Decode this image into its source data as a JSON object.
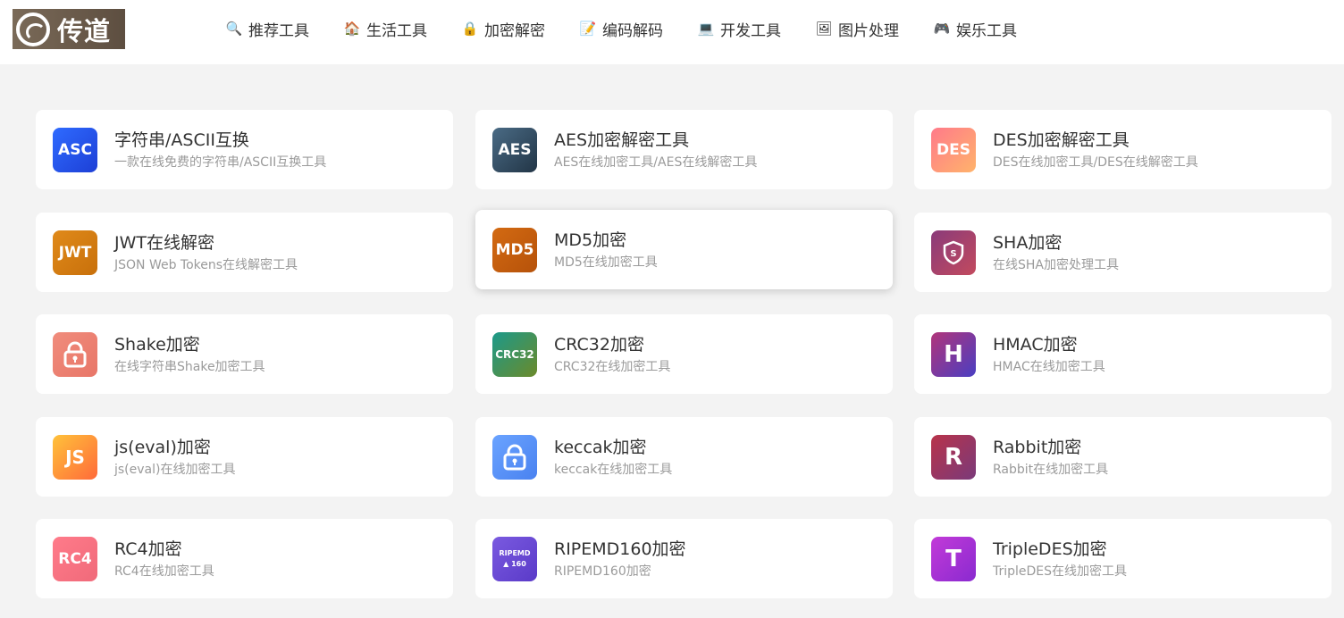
{
  "logo": {
    "text": "传道"
  },
  "nav": [
    {
      "label": "推荐工具",
      "icon": "magnifier-icon",
      "glyph": "🔍"
    },
    {
      "label": "生活工具",
      "icon": "house-icon",
      "glyph": "🏠"
    },
    {
      "label": "加密解密",
      "icon": "lock-icon",
      "glyph": "🔒"
    },
    {
      "label": "编码解码",
      "icon": "memo-icon",
      "glyph": "📝"
    },
    {
      "label": "开发工具",
      "icon": "laptop-icon",
      "glyph": "💻"
    },
    {
      "label": "图片处理",
      "icon": "picture-icon",
      "glyph": "🖼"
    },
    {
      "label": "娱乐工具",
      "icon": "gamepad-icon",
      "glyph": "🎮"
    }
  ],
  "tools": [
    {
      "title": "字符串/ASCII互换",
      "desc": "一款在线免费的字符串/ASCII互换工具",
      "tile": "ASC",
      "bg": "linear-gradient(135deg,#2f6bff,#1d3fd6)"
    },
    {
      "title": "AES加密解密工具",
      "desc": "AES在线加密工具/AES在线解密工具",
      "tile": "AES",
      "bg": "linear-gradient(135deg,#4a6b85,#223546)"
    },
    {
      "title": "DES加密解密工具",
      "desc": "DES在线加密工具/DES在线解密工具",
      "tile": "DES",
      "bg": "linear-gradient(135deg,#ff7a8a,#ffb36b)"
    },
    {
      "title": "JWT在线解密",
      "desc": "JSON Web Tokens在线解密工具",
      "tile": "JWT",
      "bg": "linear-gradient(135deg,#e08a1a,#c8700b)"
    },
    {
      "title": "MD5加密",
      "desc": "MD5在线加密工具",
      "tile": "MD5",
      "bg": "linear-gradient(135deg,#d36a12,#b6520a)"
    },
    {
      "title": "SHA加密",
      "desc": "在线SHA加密处理工具",
      "tile": "S",
      "bg": "linear-gradient(135deg,#8a3b7a,#c24a5e)"
    },
    {
      "title": "Shake加密",
      "desc": "在线字符串Shake加密工具",
      "tile": "lock",
      "bg": "linear-gradient(135deg,#f08c7c,#e87668)"
    },
    {
      "title": "CRC32加密",
      "desc": "CRC32在线加密工具",
      "tile": "CRC32",
      "bg": "linear-gradient(135deg,#1c9a8a,#6b8a2a)"
    },
    {
      "title": "HMAC加密",
      "desc": "HMAC在线加密工具",
      "tile": "H",
      "bg": "linear-gradient(135deg,#b1357a,#4a3ec2)"
    },
    {
      "title": "js(eval)加密",
      "desc": "js(eval)在线加密工具",
      "tile": "JS",
      "bg": "linear-gradient(135deg,#ffc23a,#ff6a3a)"
    },
    {
      "title": "keccak加密",
      "desc": "keccak在线加密工具",
      "tile": "lock",
      "bg": "linear-gradient(135deg,#6aa3ff,#4a82f0)"
    },
    {
      "title": "Rabbit加密",
      "desc": "Rabbit在线加密工具",
      "tile": "R",
      "bg": "linear-gradient(135deg,#b8334a,#7a3a7a)"
    },
    {
      "title": "RC4加密",
      "desc": "RC4在线加密工具",
      "tile": "RC4",
      "bg": "linear-gradient(135deg,#ff7b8a,#f06a7a)"
    },
    {
      "title": "RIPEMD160加密",
      "desc": "RIPEMD160加密",
      "tile": "RIPEMD",
      "tile2": "▲ 160",
      "bg": "linear-gradient(135deg,#7a5ae0,#5a3ac8)"
    },
    {
      "title": "TripleDES加密",
      "desc": "TripleDES在线加密工具",
      "tile": "T",
      "bg": "linear-gradient(135deg,#c23ad8,#8a2ad0)"
    }
  ]
}
